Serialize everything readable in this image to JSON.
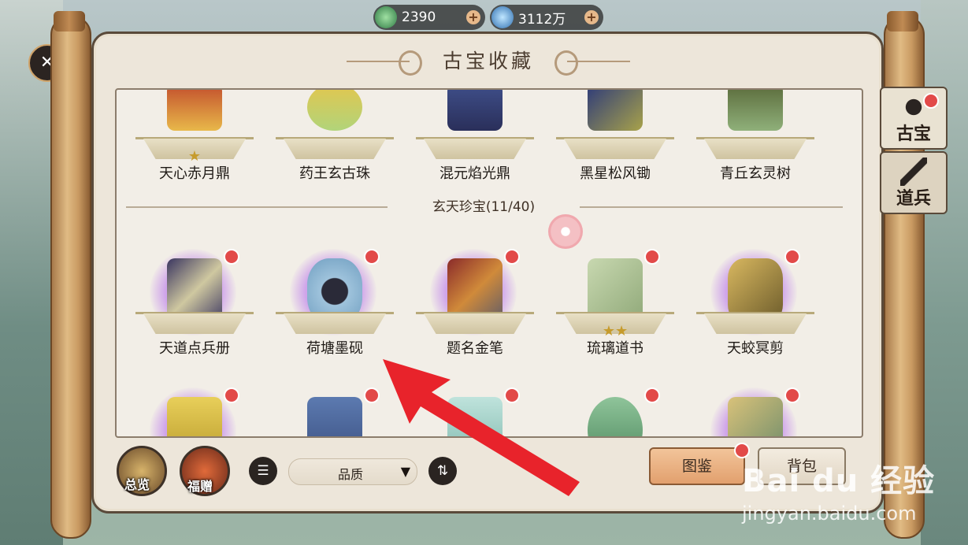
{
  "currencies": [
    {
      "icon": "jade-coin-icon",
      "value": "2390"
    },
    {
      "icon": "crystal-icon",
      "value": "3112万"
    }
  ],
  "title": "古宝收藏",
  "top_row": [
    {
      "name": "天心赤月鼎",
      "stars": "★"
    },
    {
      "name": "药王玄古珠",
      "stars": ""
    },
    {
      "name": "混元焰光鼎",
      "stars": ""
    },
    {
      "name": "黑星松风锄",
      "stars": ""
    },
    {
      "name": "青丘玄灵树",
      "stars": ""
    }
  ],
  "section_title": "玄天珍宝(11/40)",
  "middle_row": [
    {
      "name": "天道点兵册",
      "stars": ""
    },
    {
      "name": "荷塘墨砚",
      "stars": ""
    },
    {
      "name": "题名金笔",
      "stars": ""
    },
    {
      "name": "琉璃道书",
      "stars": "★★"
    },
    {
      "name": "天蛟冥剪",
      "stars": ""
    }
  ],
  "bottom_row": [
    {
      "icon": "buddha-statue-icon"
    },
    {
      "icon": "qilin-seal-icon"
    },
    {
      "icon": "jade-ribbon-icon"
    },
    {
      "icon": "lotus-crown-icon"
    },
    {
      "icon": "jade-sword-icon"
    }
  ],
  "bottom_bar": {
    "overview_label": "总览",
    "gift_label": "福赠",
    "filter_icon": "list-filter-icon",
    "sort_select": "品质",
    "sort_icon": "swap-arrows-icon",
    "codex_label": "图鉴",
    "bag_label": "背包"
  },
  "side_tabs": [
    {
      "label": "古宝",
      "icon": "treasure-icon"
    },
    {
      "label": "道兵",
      "icon": "weapon-icon"
    }
  ],
  "watermark": {
    "brand": "Bai du 经验",
    "url": "jingyan.baidu.com"
  },
  "colors": {
    "badge": "#e24a49",
    "panel": "#ede6da",
    "arrow": "#e8232b",
    "rare_glow": "#cfa4ea"
  }
}
